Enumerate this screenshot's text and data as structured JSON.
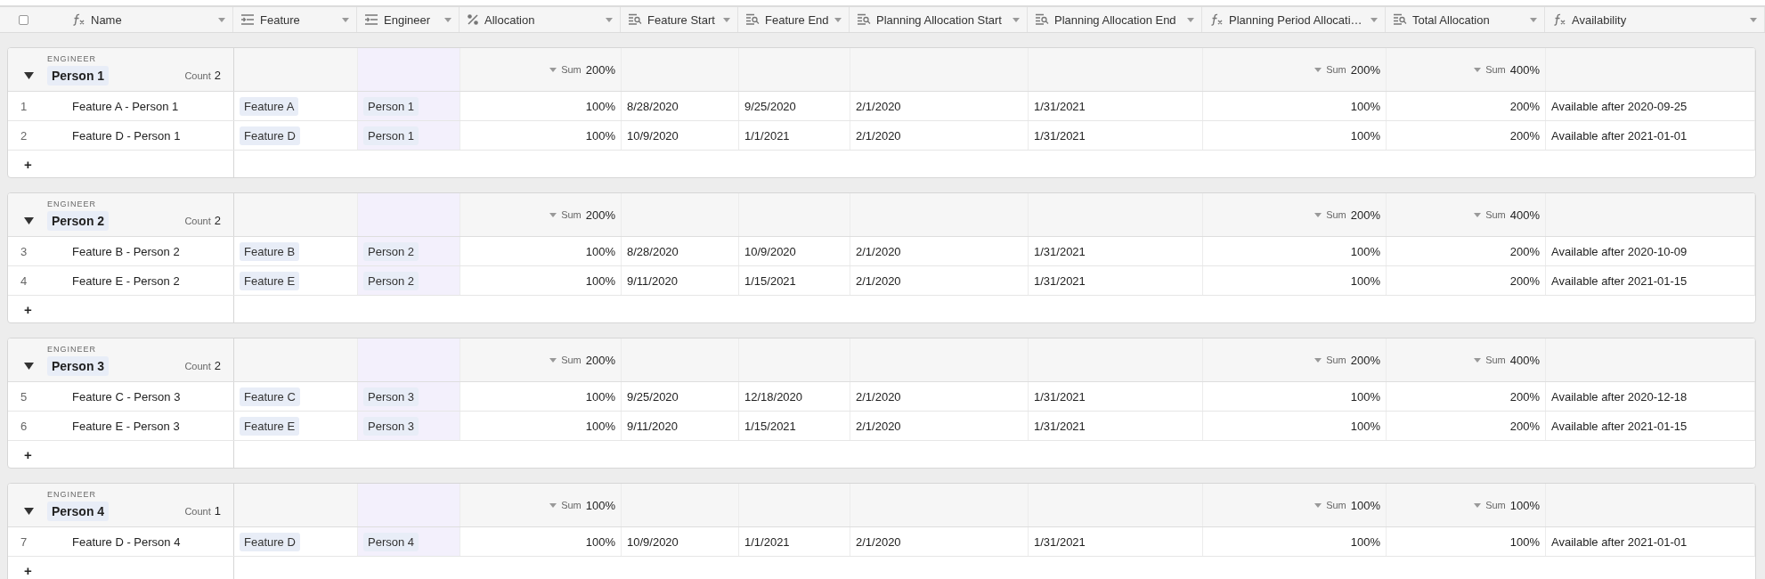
{
  "select_all": {
    "checked": false
  },
  "columns": [
    {
      "title": "Name",
      "kind": "formula"
    },
    {
      "title": "Feature",
      "kind": "link",
      "highlighted": false
    },
    {
      "title": "Engineer",
      "kind": "link",
      "highlighted": true
    },
    {
      "title": "Allocation",
      "kind": "percent",
      "highlighted": false
    },
    {
      "title": "Feature Start",
      "kind": "lookup",
      "highlighted": false
    },
    {
      "title": "Feature End",
      "kind": "lookup",
      "highlighted": false
    },
    {
      "title": "Planning Allocation Start",
      "kind": "lookup",
      "highlighted": false
    },
    {
      "title": "Planning Allocation End",
      "kind": "lookup",
      "highlighted": false
    },
    {
      "title": "Planning Period Allocati…",
      "kind": "formula",
      "highlighted": false
    },
    {
      "title": "Total Allocation",
      "kind": "lookup",
      "highlighted": false
    },
    {
      "title": "Availability",
      "kind": "formula",
      "highlighted": false
    }
  ],
  "groups": [
    {
      "field": "ENGINEER",
      "value": "Person 1",
      "count_label": "Count",
      "count": "2",
      "expanded": true,
      "allocation_sum": {
        "label": "Sum",
        "value": "200%"
      },
      "period_allocation_sum": {
        "label": "Sum",
        "value": "200%"
      },
      "total_allocation_sum": {
        "label": "Sum",
        "value": "400%"
      },
      "rows": [
        {
          "number": "1",
          "cells": [
            "Feature A - Person 1",
            "Feature A",
            "Person 1",
            "100%",
            "8/28/2020",
            "9/25/2020",
            "2/1/2020",
            "1/31/2021",
            "100%",
            "200%",
            "Available after 2020-09-25"
          ]
        },
        {
          "number": "2",
          "cells": [
            "Feature D - Person 1",
            "Feature D",
            "Person 1",
            "100%",
            "10/9/2020",
            "1/1/2021",
            "2/1/2020",
            "1/31/2021",
            "100%",
            "200%",
            "Available after 2021-01-01"
          ]
        }
      ],
      "add_label": "+"
    },
    {
      "field": "ENGINEER",
      "value": "Person 2",
      "count_label": "Count",
      "count": "2",
      "expanded": true,
      "allocation_sum": {
        "label": "Sum",
        "value": "200%"
      },
      "period_allocation_sum": {
        "label": "Sum",
        "value": "200%"
      },
      "total_allocation_sum": {
        "label": "Sum",
        "value": "400%"
      },
      "rows": [
        {
          "number": "3",
          "cells": [
            "Feature B - Person 2",
            "Feature B",
            "Person 2",
            "100%",
            "8/28/2020",
            "10/9/2020",
            "2/1/2020",
            "1/31/2021",
            "100%",
            "200%",
            "Available after 2020-10-09"
          ]
        },
        {
          "number": "4",
          "cells": [
            "Feature E - Person 2",
            "Feature E",
            "Person 2",
            "100%",
            "9/11/2020",
            "1/15/2021",
            "2/1/2020",
            "1/31/2021",
            "100%",
            "200%",
            "Available after 2021-01-15"
          ]
        }
      ],
      "add_label": "+"
    },
    {
      "field": "ENGINEER",
      "value": "Person 3",
      "count_label": "Count",
      "count": "2",
      "expanded": true,
      "allocation_sum": {
        "label": "Sum",
        "value": "200%"
      },
      "period_allocation_sum": {
        "label": "Sum",
        "value": "200%"
      },
      "total_allocation_sum": {
        "label": "Sum",
        "value": "400%"
      },
      "rows": [
        {
          "number": "5",
          "cells": [
            "Feature C - Person 3",
            "Feature C",
            "Person 3",
            "100%",
            "9/25/2020",
            "12/18/2020",
            "2/1/2020",
            "1/31/2021",
            "100%",
            "200%",
            "Available after 2020-12-18"
          ]
        },
        {
          "number": "6",
          "cells": [
            "Feature E - Person 3",
            "Feature E",
            "Person 3",
            "100%",
            "9/11/2020",
            "1/15/2021",
            "2/1/2020",
            "1/31/2021",
            "100%",
            "200%",
            "Available after 2021-01-15"
          ]
        }
      ],
      "add_label": "+"
    },
    {
      "field": "ENGINEER",
      "value": "Person 4",
      "count_label": "Count",
      "count": "1",
      "expanded": true,
      "allocation_sum": {
        "label": "Sum",
        "value": "100%"
      },
      "period_allocation_sum": {
        "label": "Sum",
        "value": "100%"
      },
      "total_allocation_sum": {
        "label": "Sum",
        "value": "100%"
      },
      "rows": [
        {
          "number": "7",
          "cells": [
            "Feature D - Person 4",
            "Feature D",
            "Person 4",
            "100%",
            "10/9/2020",
            "1/1/2021",
            "2/1/2020",
            "1/31/2021",
            "100%",
            "100%",
            "Available after 2021-01-01"
          ]
        }
      ],
      "add_label": "+"
    }
  ]
}
